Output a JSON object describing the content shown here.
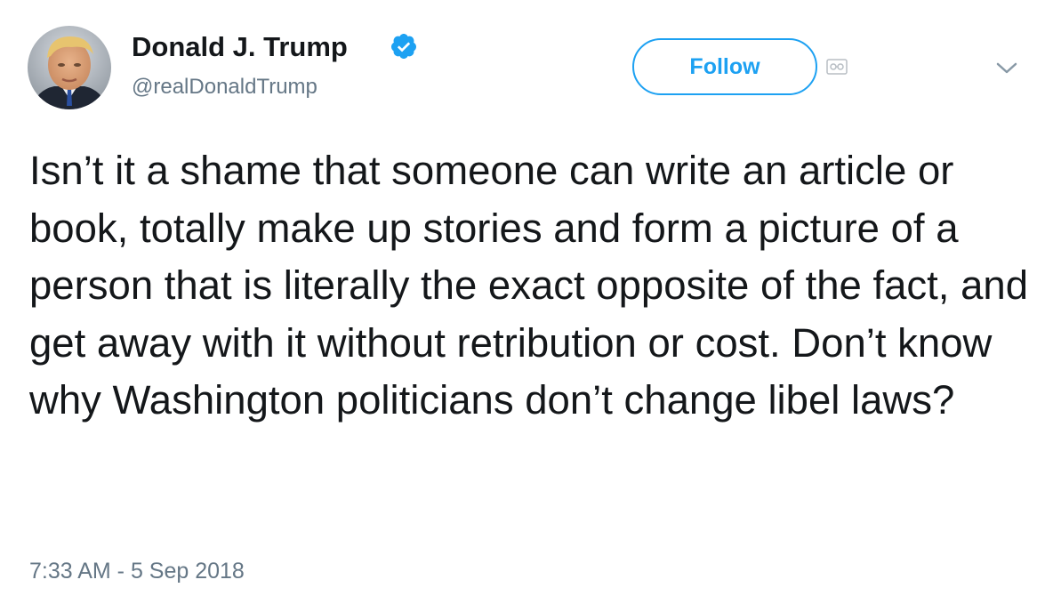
{
  "user": {
    "name": "Donald J. Trump",
    "handle": "@realDonaldTrump",
    "verified": true,
    "verified_color": "#1da1f2",
    "avatar_icon": "profile-photo"
  },
  "actions": {
    "follow_label": "Follow",
    "menu_icon": "chevron-down-icon"
  },
  "tweet": {
    "text": "Isn’t it a shame that someone can write an article or book, totally make up stories and form a picture of a person that is literally the exact opposite of the fact, and get away with it without retribution or cost. Don’t know why Washington politicians don’t change libel laws?",
    "timestamp": "7:33 AM - 5 Sep 2018"
  },
  "colors": {
    "accent": "#1da1f2",
    "text": "#14171a",
    "secondary_text": "#657786"
  }
}
